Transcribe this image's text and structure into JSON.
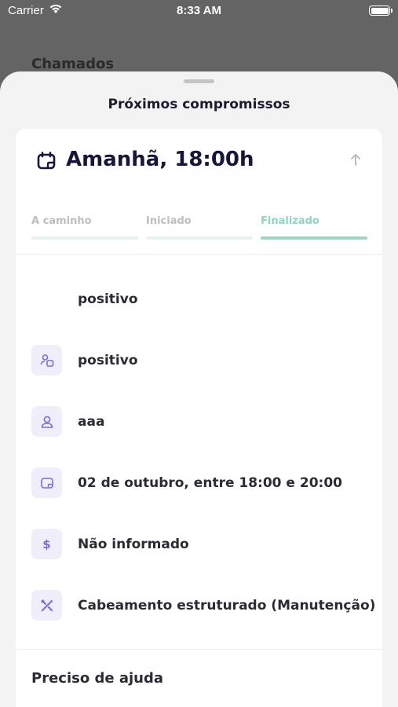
{
  "status_bar": {
    "carrier": "Carrier",
    "time": "8:33 AM"
  },
  "background": {
    "title": "Chamados"
  },
  "sheet": {
    "title": "Próximos compromissos",
    "card": {
      "heading": "Amanhã, 18:00h",
      "steps": [
        {
          "label": "A caminho",
          "active": false
        },
        {
          "label": "Iniciado",
          "active": false
        },
        {
          "label": "Finalizado",
          "active": true
        }
      ],
      "details": [
        {
          "icon": "none",
          "text": "positivo"
        },
        {
          "icon": "company-icon",
          "text": "positivo"
        },
        {
          "icon": "user-icon",
          "text": "aaa"
        },
        {
          "icon": "calendar-icon",
          "text": "02 de outubro, entre 18:00 e 20:00"
        },
        {
          "icon": "dollar-icon",
          "text": "Não informado"
        },
        {
          "icon": "tools-icon",
          "text": "Cabeamento estruturado (Manutenção)"
        }
      ],
      "help_label": "Preciso de ajuda"
    }
  },
  "colors": {
    "accent": "#7b6ce0",
    "success": "#9ad9c4",
    "icon_bg": "#efeefa"
  }
}
